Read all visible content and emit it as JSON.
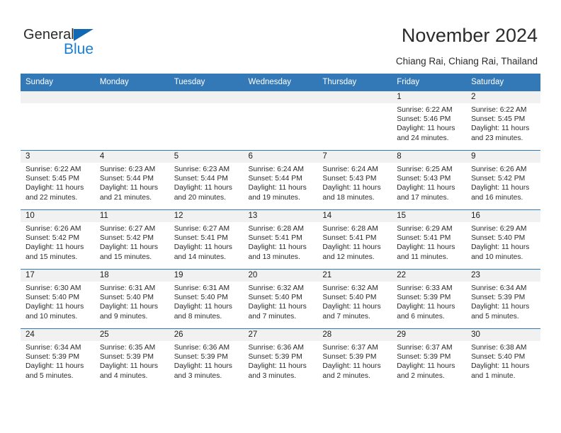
{
  "brand": {
    "name_part1": "General",
    "name_part2": "Blue",
    "triangle_color": "#1268b3",
    "blue_color": "#1a7fd4"
  },
  "header": {
    "title": "November 2024",
    "subtitle": "Chiang Rai, Chiang Rai, Thailand"
  },
  "theme": {
    "header_bg": "#3479b7",
    "daynum_bg": "#f1f1f1",
    "cell_border": "#3479b7"
  },
  "weekdays": [
    "Sunday",
    "Monday",
    "Tuesday",
    "Wednesday",
    "Thursday",
    "Friday",
    "Saturday"
  ],
  "weeks": [
    [
      {
        "day": "",
        "sunrise": "",
        "sunset": "",
        "daylight1": "",
        "daylight2": ""
      },
      {
        "day": "",
        "sunrise": "",
        "sunset": "",
        "daylight1": "",
        "daylight2": ""
      },
      {
        "day": "",
        "sunrise": "",
        "sunset": "",
        "daylight1": "",
        "daylight2": ""
      },
      {
        "day": "",
        "sunrise": "",
        "sunset": "",
        "daylight1": "",
        "daylight2": ""
      },
      {
        "day": "",
        "sunrise": "",
        "sunset": "",
        "daylight1": "",
        "daylight2": ""
      },
      {
        "day": "1",
        "sunrise": "Sunrise: 6:22 AM",
        "sunset": "Sunset: 5:46 PM",
        "daylight1": "Daylight: 11 hours",
        "daylight2": "and 24 minutes."
      },
      {
        "day": "2",
        "sunrise": "Sunrise: 6:22 AM",
        "sunset": "Sunset: 5:45 PM",
        "daylight1": "Daylight: 11 hours",
        "daylight2": "and 23 minutes."
      }
    ],
    [
      {
        "day": "3",
        "sunrise": "Sunrise: 6:22 AM",
        "sunset": "Sunset: 5:45 PM",
        "daylight1": "Daylight: 11 hours",
        "daylight2": "and 22 minutes."
      },
      {
        "day": "4",
        "sunrise": "Sunrise: 6:23 AM",
        "sunset": "Sunset: 5:44 PM",
        "daylight1": "Daylight: 11 hours",
        "daylight2": "and 21 minutes."
      },
      {
        "day": "5",
        "sunrise": "Sunrise: 6:23 AM",
        "sunset": "Sunset: 5:44 PM",
        "daylight1": "Daylight: 11 hours",
        "daylight2": "and 20 minutes."
      },
      {
        "day": "6",
        "sunrise": "Sunrise: 6:24 AM",
        "sunset": "Sunset: 5:44 PM",
        "daylight1": "Daylight: 11 hours",
        "daylight2": "and 19 minutes."
      },
      {
        "day": "7",
        "sunrise": "Sunrise: 6:24 AM",
        "sunset": "Sunset: 5:43 PM",
        "daylight1": "Daylight: 11 hours",
        "daylight2": "and 18 minutes."
      },
      {
        "day": "8",
        "sunrise": "Sunrise: 6:25 AM",
        "sunset": "Sunset: 5:43 PM",
        "daylight1": "Daylight: 11 hours",
        "daylight2": "and 17 minutes."
      },
      {
        "day": "9",
        "sunrise": "Sunrise: 6:26 AM",
        "sunset": "Sunset: 5:42 PM",
        "daylight1": "Daylight: 11 hours",
        "daylight2": "and 16 minutes."
      }
    ],
    [
      {
        "day": "10",
        "sunrise": "Sunrise: 6:26 AM",
        "sunset": "Sunset: 5:42 PM",
        "daylight1": "Daylight: 11 hours",
        "daylight2": "and 15 minutes."
      },
      {
        "day": "11",
        "sunrise": "Sunrise: 6:27 AM",
        "sunset": "Sunset: 5:42 PM",
        "daylight1": "Daylight: 11 hours",
        "daylight2": "and 15 minutes."
      },
      {
        "day": "12",
        "sunrise": "Sunrise: 6:27 AM",
        "sunset": "Sunset: 5:41 PM",
        "daylight1": "Daylight: 11 hours",
        "daylight2": "and 14 minutes."
      },
      {
        "day": "13",
        "sunrise": "Sunrise: 6:28 AM",
        "sunset": "Sunset: 5:41 PM",
        "daylight1": "Daylight: 11 hours",
        "daylight2": "and 13 minutes."
      },
      {
        "day": "14",
        "sunrise": "Sunrise: 6:28 AM",
        "sunset": "Sunset: 5:41 PM",
        "daylight1": "Daylight: 11 hours",
        "daylight2": "and 12 minutes."
      },
      {
        "day": "15",
        "sunrise": "Sunrise: 6:29 AM",
        "sunset": "Sunset: 5:41 PM",
        "daylight1": "Daylight: 11 hours",
        "daylight2": "and 11 minutes."
      },
      {
        "day": "16",
        "sunrise": "Sunrise: 6:29 AM",
        "sunset": "Sunset: 5:40 PM",
        "daylight1": "Daylight: 11 hours",
        "daylight2": "and 10 minutes."
      }
    ],
    [
      {
        "day": "17",
        "sunrise": "Sunrise: 6:30 AM",
        "sunset": "Sunset: 5:40 PM",
        "daylight1": "Daylight: 11 hours",
        "daylight2": "and 10 minutes."
      },
      {
        "day": "18",
        "sunrise": "Sunrise: 6:31 AM",
        "sunset": "Sunset: 5:40 PM",
        "daylight1": "Daylight: 11 hours",
        "daylight2": "and 9 minutes."
      },
      {
        "day": "19",
        "sunrise": "Sunrise: 6:31 AM",
        "sunset": "Sunset: 5:40 PM",
        "daylight1": "Daylight: 11 hours",
        "daylight2": "and 8 minutes."
      },
      {
        "day": "20",
        "sunrise": "Sunrise: 6:32 AM",
        "sunset": "Sunset: 5:40 PM",
        "daylight1": "Daylight: 11 hours",
        "daylight2": "and 7 minutes."
      },
      {
        "day": "21",
        "sunrise": "Sunrise: 6:32 AM",
        "sunset": "Sunset: 5:40 PM",
        "daylight1": "Daylight: 11 hours",
        "daylight2": "and 7 minutes."
      },
      {
        "day": "22",
        "sunrise": "Sunrise: 6:33 AM",
        "sunset": "Sunset: 5:39 PM",
        "daylight1": "Daylight: 11 hours",
        "daylight2": "and 6 minutes."
      },
      {
        "day": "23",
        "sunrise": "Sunrise: 6:34 AM",
        "sunset": "Sunset: 5:39 PM",
        "daylight1": "Daylight: 11 hours",
        "daylight2": "and 5 minutes."
      }
    ],
    [
      {
        "day": "24",
        "sunrise": "Sunrise: 6:34 AM",
        "sunset": "Sunset: 5:39 PM",
        "daylight1": "Daylight: 11 hours",
        "daylight2": "and 5 minutes."
      },
      {
        "day": "25",
        "sunrise": "Sunrise: 6:35 AM",
        "sunset": "Sunset: 5:39 PM",
        "daylight1": "Daylight: 11 hours",
        "daylight2": "and 4 minutes."
      },
      {
        "day": "26",
        "sunrise": "Sunrise: 6:36 AM",
        "sunset": "Sunset: 5:39 PM",
        "daylight1": "Daylight: 11 hours",
        "daylight2": "and 3 minutes."
      },
      {
        "day": "27",
        "sunrise": "Sunrise: 6:36 AM",
        "sunset": "Sunset: 5:39 PM",
        "daylight1": "Daylight: 11 hours",
        "daylight2": "and 3 minutes."
      },
      {
        "day": "28",
        "sunrise": "Sunrise: 6:37 AM",
        "sunset": "Sunset: 5:39 PM",
        "daylight1": "Daylight: 11 hours",
        "daylight2": "and 2 minutes."
      },
      {
        "day": "29",
        "sunrise": "Sunrise: 6:37 AM",
        "sunset": "Sunset: 5:39 PM",
        "daylight1": "Daylight: 11 hours",
        "daylight2": "and 2 minutes."
      },
      {
        "day": "30",
        "sunrise": "Sunrise: 6:38 AM",
        "sunset": "Sunset: 5:40 PM",
        "daylight1": "Daylight: 11 hours",
        "daylight2": "and 1 minute."
      }
    ]
  ]
}
